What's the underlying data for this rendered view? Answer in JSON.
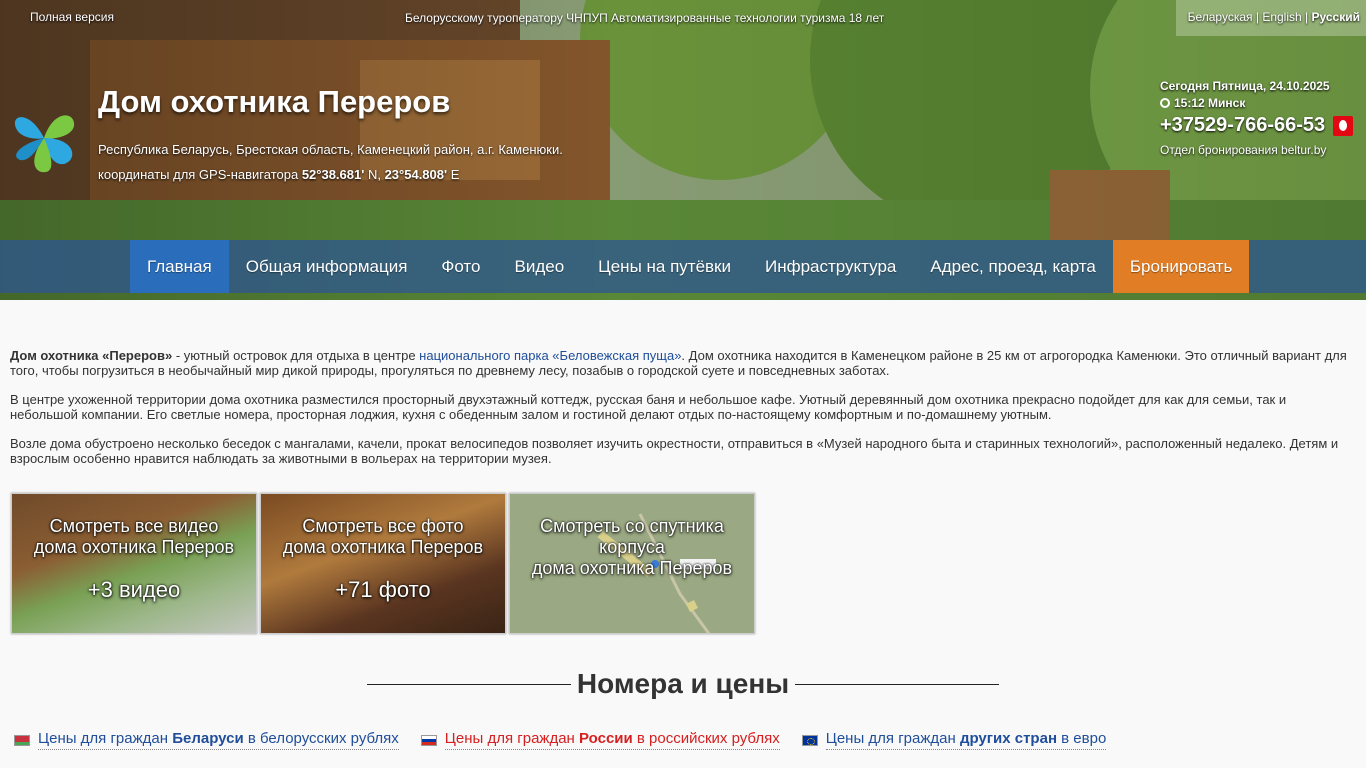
{
  "header": {
    "full_version": "Полная версия",
    "tagline": "Белорусскому туроператору ЧНПУП Автоматизированные технологии туризма 18 лет",
    "langs": [
      "Беларуская",
      "English",
      "Русский"
    ],
    "lang_sep": "|",
    "title": "Дом охотника Переров",
    "address": "Республика Беларусь, Брестская область, Каменецкий район, а.г. Каменюки.",
    "gps_prefix": "координаты для GPS-навигатора",
    "gps_lat": "52°38.681'",
    "gps_n": "N,",
    "gps_lon": "23°54.808'",
    "gps_e": "E",
    "today": "Сегодня Пятница, 24.10.2025",
    "time": "15:12 Минск",
    "phone": "+37529-766-66-53",
    "booking_dept": "Отдел бронирования beltur.by"
  },
  "nav": {
    "items": [
      "Главная",
      "Общая информация",
      "Фото",
      "Видео",
      "Цены на путёвки",
      "Инфраструктура",
      "Адрес, проезд, карта",
      "Бронировать"
    ]
  },
  "content": {
    "p1_bold": "Дом охотника «Переров»",
    "p1_a": " - уютный островок для отдыха в центре ",
    "p1_link": "национального парка «Беловежская пуща»",
    "p1_b": ". Дом охотника находится в Каменецком районе в 25 км от агрогородка Каменюки. Это отличный вариант для того, чтобы погрузиться в необычайный мир дикой природы, прогуляться по древнему лесу, позабыв о городской суете и повседневных заботах.",
    "p2": "В центре ухоженной территории дома охотника разместился просторный двухэтажный коттедж, русская баня и небольшое кафе. Уютный деревянный дом охотника прекрасно подойдет для как для семьи, так и небольшой компании. Его светлые номера, просторная лоджия, кухня с обеденным залом и гостиной делают отдых по-настоящему комфортным и по-домашнему уютным.",
    "p3": "Возле дома обустроено несколько беседок с мангалами, качели, прокат велосипедов позволяет изучить окрестности, отправиться в «Музей народного быта и старинных технологий», расположенный недалеко. Детям и взрослым особенно нравится наблюдать за животными в вольерах на территории музея."
  },
  "tiles": {
    "video_l1": "Смотреть все видео",
    "video_l2": "дома охотника Переров",
    "video_count": "+3 видео",
    "photo_l1": "Смотреть все фото",
    "photo_l2": "дома охотника Переров",
    "photo_count": "+71 фото",
    "map_l1": "Смотреть со спутника",
    "map_l2": "корпуса",
    "map_l3": "дома охотника Переров"
  },
  "rooms": {
    "heading": "Номера и цены"
  },
  "prices": {
    "by_a": "Цены для граждан ",
    "by_b": "Беларуси",
    "by_c": " в белорусских рублях",
    "ru_a": "Цены для граждан ",
    "ru_b": "России",
    "ru_c": " в российских рублях",
    "eu_a": "Цены для граждан ",
    "eu_b": "других стран",
    "eu_c": " в евро"
  },
  "colors": {
    "nav_active": "#2a6ebb",
    "nav_book": "#e07d25",
    "link": "#1f4e9a",
    "russia_link": "#d42020"
  }
}
